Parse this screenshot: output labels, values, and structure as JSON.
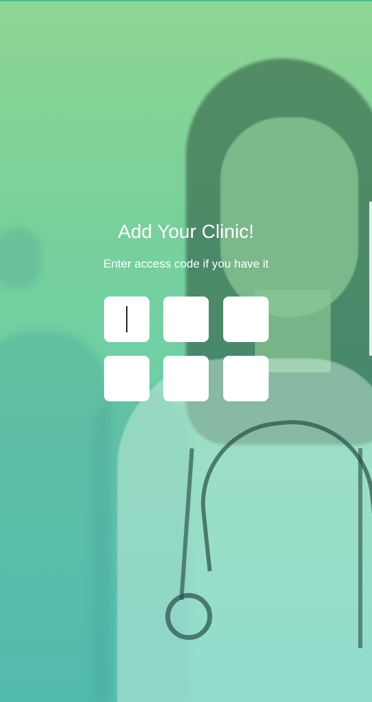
{
  "colors": {
    "gradient_top": "#8fd693",
    "gradient_bottom": "#5bc9b8",
    "text": "#ffffff",
    "input_background": "#ffffff"
  },
  "screen": {
    "title": "Add Your Clinic!",
    "subtitle": "Enter access code if you have it"
  },
  "access_code": {
    "digits": [
      "",
      "",
      "",
      "",
      "",
      ""
    ],
    "focused_index": 0
  }
}
